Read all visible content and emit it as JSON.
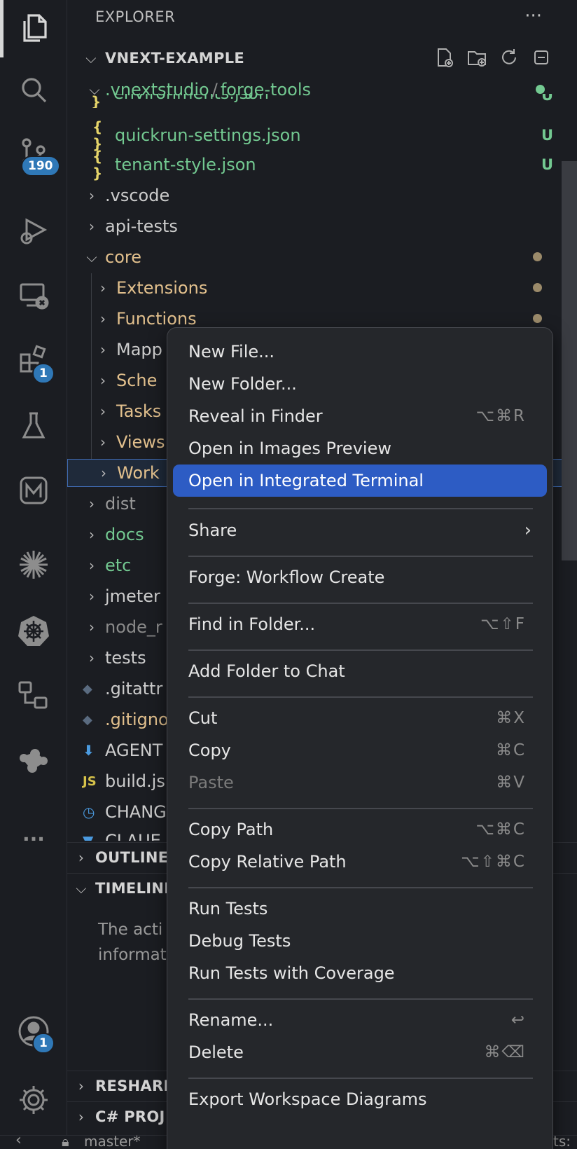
{
  "activity_bar": {
    "source_control_badge": "190",
    "extensions_badge": "1",
    "accounts_badge": "1",
    "more_label": "..."
  },
  "sidebar": {
    "title": "EXPLORER",
    "more": "···",
    "project_header": "VNEXT-EXAMPLE",
    "sections": {
      "outline": "OUTLINE",
      "timeline": "TIMELINE",
      "timeline_message_1": "The acti",
      "timeline_message_2": "informat",
      "resharper": "RESHARI",
      "csharp_project": "C# PROJ"
    },
    "tree": {
      "folder_path_part1": ".vnextstudio",
      "folder_path_sep": "/",
      "folder_path_part2": "forge-tools",
      "partial_top": "environments.json",
      "items": [
        {
          "label": "quickrun-settings.json",
          "icon": "{ }",
          "deco": "U"
        },
        {
          "label": "tenant-style.json",
          "icon": "{ }",
          "deco": "U"
        },
        {
          "label": ".vscode"
        },
        {
          "label": "api-tests"
        },
        {
          "label": "core"
        },
        {
          "label": "Extensions"
        },
        {
          "label": "Functions"
        },
        {
          "label": "Mapp"
        },
        {
          "label": "Sche"
        },
        {
          "label": "Tasks"
        },
        {
          "label": "Views"
        },
        {
          "label": "Work"
        },
        {
          "label": "dist"
        },
        {
          "label": "docs"
        },
        {
          "label": "etc"
        },
        {
          "label": "jmeter"
        },
        {
          "label": "node_r"
        },
        {
          "label": "tests"
        },
        {
          "label": ".gitattr"
        },
        {
          "label": ".gitigno"
        },
        {
          "label": "AGENT"
        },
        {
          "label": "build.js",
          "icon": "JS"
        },
        {
          "label": "CHANG"
        },
        {
          "label": "CLAUE"
        }
      ],
      "partial_deco": "U"
    }
  },
  "context_menu": {
    "items": [
      {
        "label": "New File..."
      },
      {
        "label": "New Folder..."
      },
      {
        "label": "Reveal in Finder",
        "shortcut": "⌥⌘R"
      },
      {
        "label": "Open in Images Preview"
      },
      {
        "label": "Open in Integrated Terminal"
      },
      {
        "label": "Share",
        "submenu": "›"
      },
      {
        "label": "Forge: Workflow Create"
      },
      {
        "label": "Find in Folder...",
        "shortcut": "⌥⇧F"
      },
      {
        "label": "Add Folder to Chat"
      },
      {
        "label": "Cut",
        "shortcut": "⌘X"
      },
      {
        "label": "Copy",
        "shortcut": "⌘C"
      },
      {
        "label": "Paste",
        "shortcut": "⌘V"
      },
      {
        "label": "Copy Path",
        "shortcut": "⌥⌘C"
      },
      {
        "label": "Copy Relative Path",
        "shortcut": "⌥⇧⌘C"
      },
      {
        "label": "Run Tests"
      },
      {
        "label": "Debug Tests"
      },
      {
        "label": "Run Tests with Coverage"
      },
      {
        "label": "Rename...",
        "shortcut": "↩"
      },
      {
        "label": "Delete",
        "shortcut": "⌘⌫"
      },
      {
        "label": "Export Workspace Diagrams"
      }
    ]
  },
  "status_bar": {
    "branch": "master*",
    "right_partial": "ts:"
  },
  "colors": {
    "highlight": "#2d5cc4",
    "untracked_green": "#73c991",
    "modified_yellow": "#e2c08d",
    "badge_blue": "#2f78b7"
  }
}
